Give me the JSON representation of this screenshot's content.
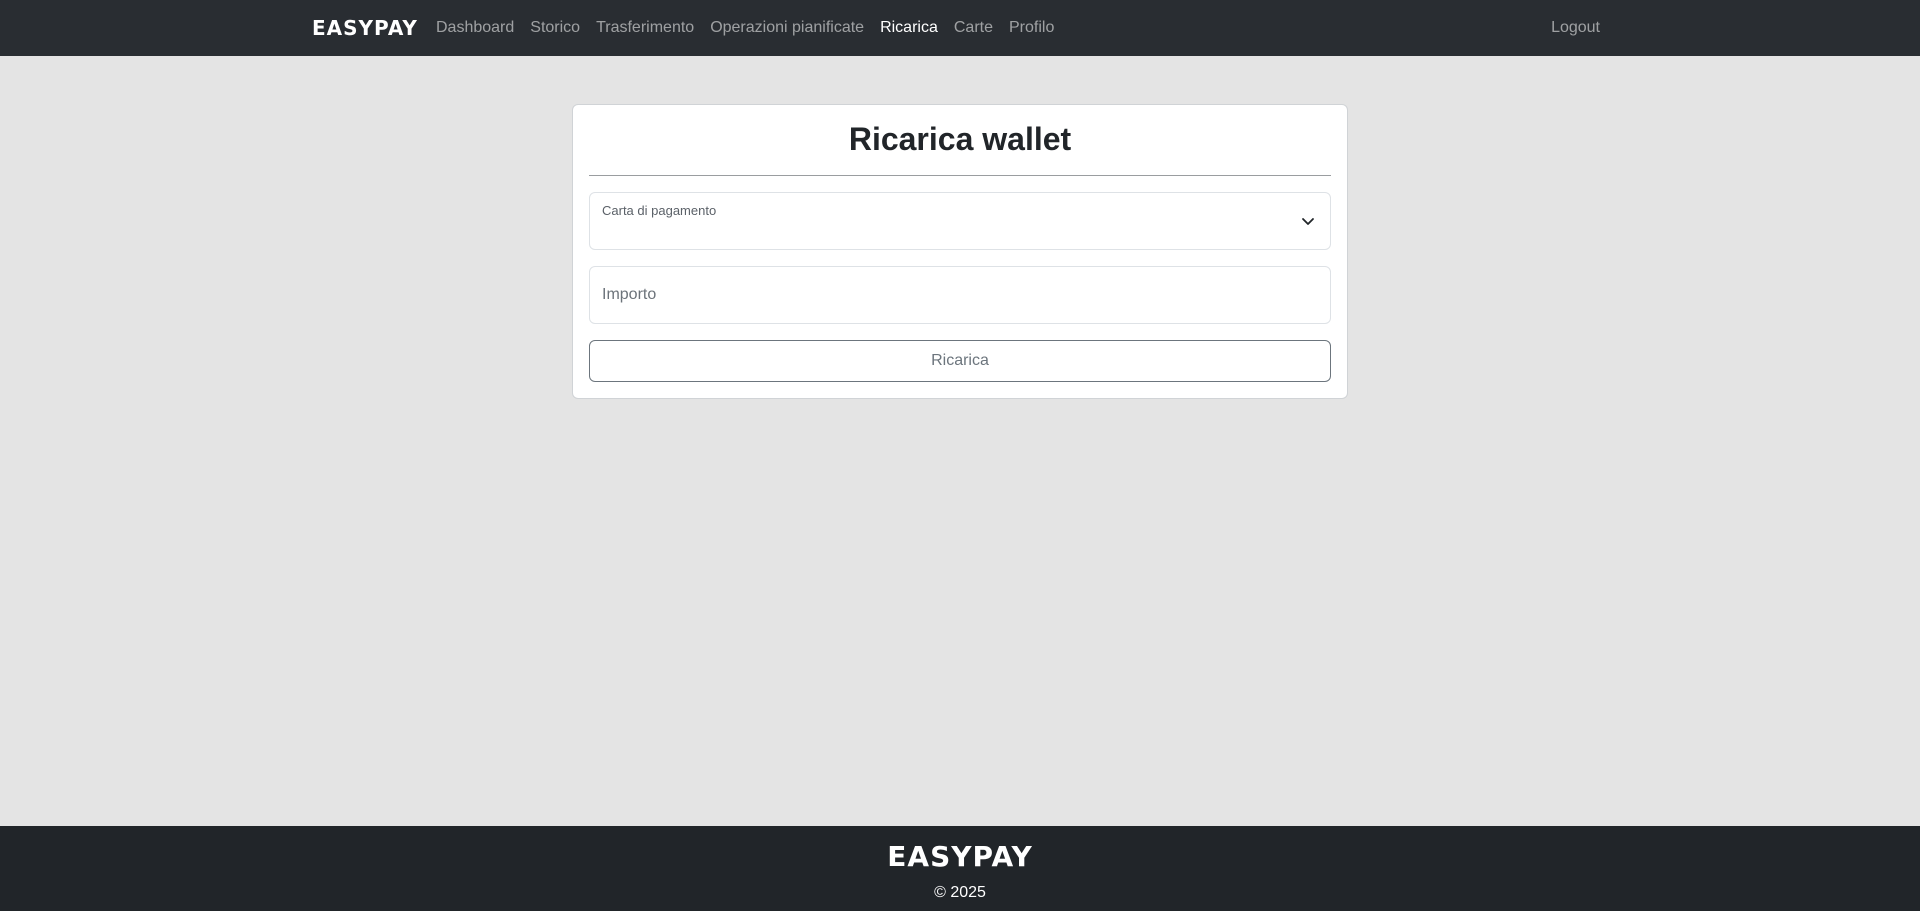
{
  "navbar": {
    "brand": "EASYPAY",
    "links": [
      {
        "label": "Dashboard",
        "active": false
      },
      {
        "label": "Storico",
        "active": false
      },
      {
        "label": "Trasferimento",
        "active": false
      },
      {
        "label": "Operazioni pianificate",
        "active": false
      },
      {
        "label": "Ricarica",
        "active": true
      },
      {
        "label": "Carte",
        "active": false
      },
      {
        "label": "Profilo",
        "active": false
      }
    ],
    "logout_label": "Logout"
  },
  "form": {
    "title": "Ricarica wallet",
    "card_select_label": "Carta di pagamento",
    "card_select_value": "",
    "amount_placeholder": "Importo",
    "amount_value": "",
    "submit_label": "Ricarica"
  },
  "footer": {
    "brand": "EASYPAY",
    "copyright": "© 2025"
  },
  "colors": {
    "navbar_bg": "#292d32",
    "page_bg": "#e4e4e4",
    "footer_bg": "#212529",
    "button_border": "#6c757d"
  }
}
